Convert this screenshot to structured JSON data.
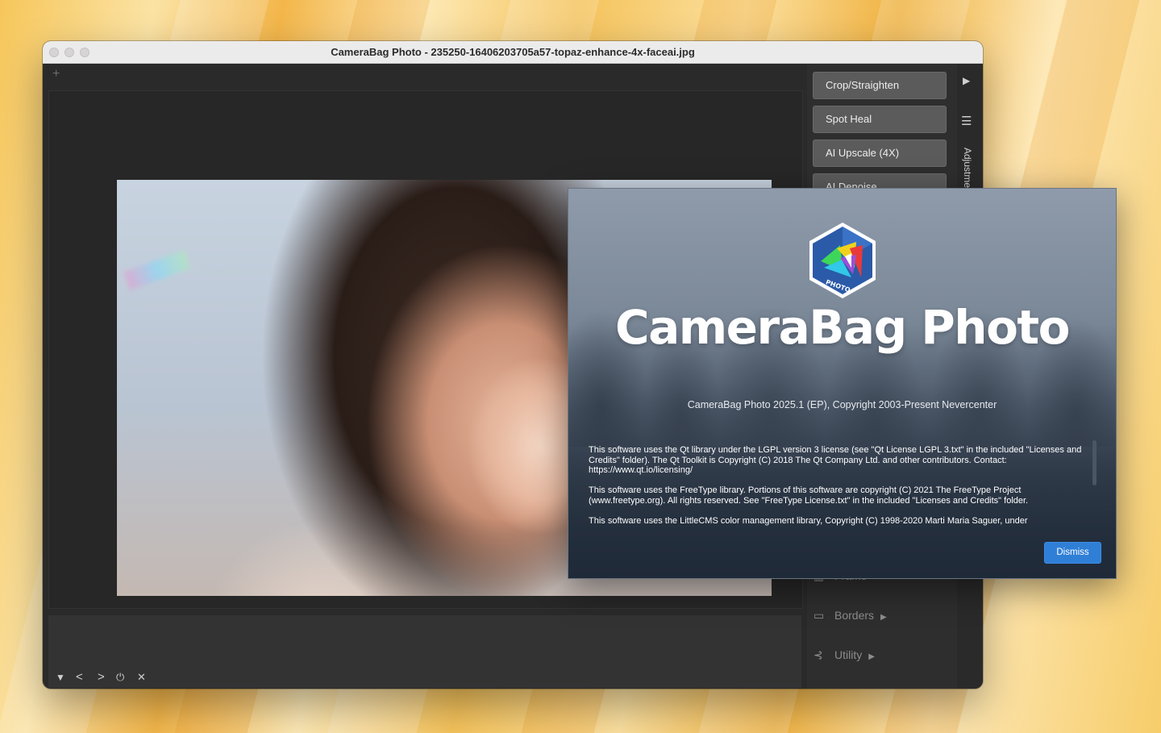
{
  "window": {
    "title": "CameraBag Photo - 235250-16406203705a57-topaz-enhance-4x-faceai.jpg",
    "new_tab": "+"
  },
  "filmstrip_controls": {
    "collapse": "▼",
    "prev": "<",
    "next": ">",
    "power": "⏻",
    "close": "✕"
  },
  "sidebar": {
    "tools": [
      "Crop/Straighten",
      "Spot Heal",
      "AI Upscale (4X)",
      "AI Denoise"
    ],
    "categories": [
      {
        "label": "Frame",
        "icon": "frame-icon"
      },
      {
        "label": "Borders",
        "icon": "border-icon"
      },
      {
        "label": "Utility",
        "icon": "utility-icon"
      }
    ],
    "rail": {
      "expand_icon": "▶",
      "menu_icon": "☰",
      "tab_label": "Adjustme"
    }
  },
  "about": {
    "brand": "CameraBag Photo",
    "logo_text": "PHOTO",
    "version": "CameraBag Photo 2025.1 (EP), Copyright 2003-Present Nevercenter",
    "license_qt": "This software uses the Qt library under the LGPL version 3 license (see \"Qt License LGPL 3.txt\" in the included \"Licenses and Credits\" folder). The Qt Toolkit is Copyright (C) 2018 The Qt Company Ltd. and other contributors. Contact: https://www.qt.io/licensing/",
    "license_freetype": "This software uses the FreeType library. Portions of this software are copyright (C) 2021 The FreeType Project (www.freetype.org).  All rights reserved. See \"FreeType License.txt\" in the included \"Licenses and Credits\" folder.",
    "license_lcms": "This software uses the LittleCMS color management library, Copyright (C) 1998-2020 Marti Maria Saguer, under",
    "dismiss_label": "Dismiss"
  },
  "colors": {
    "accent": "#2f7fd6",
    "window_bg": "#2a2a2a",
    "tool_button": "#5b5b5b"
  }
}
